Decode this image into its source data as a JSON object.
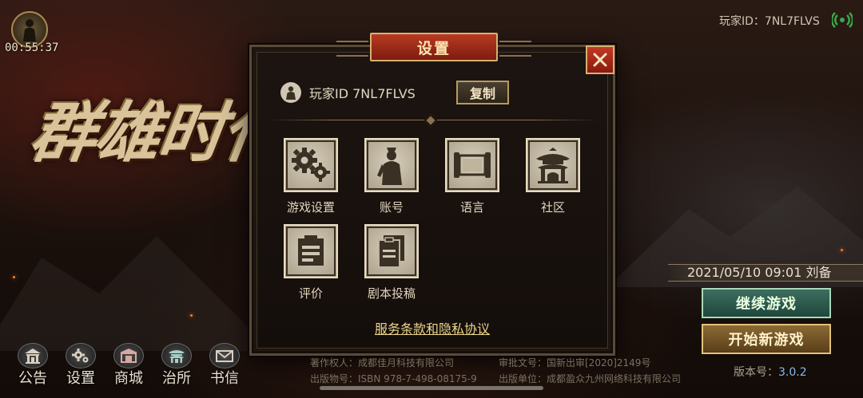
{
  "status": {
    "time": "00:55:37"
  },
  "logo": {
    "text": "群雄时代"
  },
  "top": {
    "player_id": "玩家ID：7NL7FLVS"
  },
  "modal": {
    "title": "设置",
    "player_id_label": "玩家ID 7NL7FLVS",
    "copy_label": "复制",
    "items": [
      {
        "label": "游戏设置",
        "icon": "gears-icon"
      },
      {
        "label": "账号",
        "icon": "person-icon"
      },
      {
        "label": "语言",
        "icon": "scroll-icon"
      },
      {
        "label": "社区",
        "icon": "pavilion-icon"
      },
      {
        "label": "评价",
        "icon": "clipboard-icon"
      },
      {
        "label": "剧本投稿",
        "icon": "documents-icon"
      }
    ],
    "terms_link": "服务条款和隐私协议"
  },
  "save": {
    "info": "2021/05/10 09:01 刘备"
  },
  "buttons": {
    "continue": "继续游戏",
    "new_game": "开始新游戏"
  },
  "version": {
    "label": "版本号：",
    "number": "3.0.2"
  },
  "nav": [
    {
      "label": "公告",
      "icon": "temple-icon"
    },
    {
      "label": "设置",
      "icon": "gear-icon"
    },
    {
      "label": "商城",
      "icon": "shop-icon"
    },
    {
      "label": "治所",
      "icon": "palace-icon"
    },
    {
      "label": "书信",
      "icon": "envelope-icon"
    }
  ],
  "copyright": {
    "owner": "著作权人：成都佳月科技有限公司",
    "approval": "审批文号：国新出审[2020]2149号",
    "isbn": "出版物号：ISBN 978-7-498-08175-9",
    "publisher": "出版单位：成都盈众九州网络科技有限公司"
  },
  "colors": {
    "accent_red": "#b93a22",
    "gold": "#d9b070",
    "continue_green": "#3e6e60",
    "new_game_gold": "#8a6a34",
    "link_yellow": "#ecd48a",
    "signal_green": "#3aa84a"
  }
}
